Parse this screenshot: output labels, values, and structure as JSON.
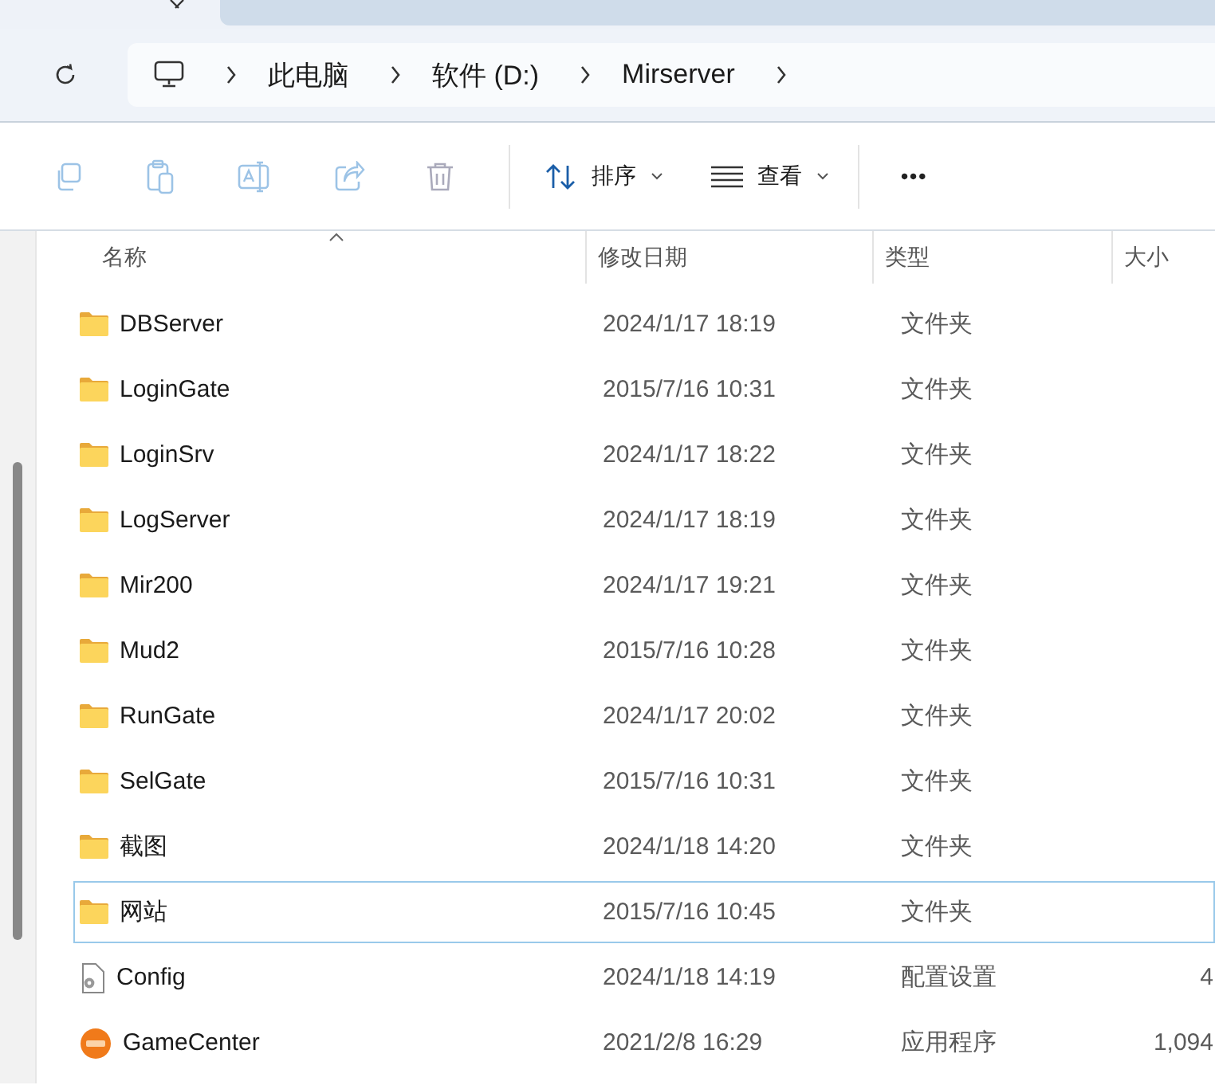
{
  "address_bar": {
    "crumbs": [
      "此电脑",
      "软件 (D:)",
      "Mirserver"
    ]
  },
  "toolbar": {
    "sort": "排序",
    "view": "查看",
    "more": "•••"
  },
  "table": {
    "columns": [
      {
        "label": "名称",
        "sorted": true
      },
      {
        "label": "修改日期",
        "sorted": false
      },
      {
        "label": "类型",
        "sorted": false
      },
      {
        "label": "大小",
        "sorted": false
      }
    ],
    "rows": [
      {
        "kind": "folder",
        "name": "DBServer",
        "date": "2024/1/17 18:19",
        "type": "文件夹",
        "focused": false
      },
      {
        "kind": "folder",
        "name": "LoginGate",
        "date": "2015/7/16 10:31",
        "type": "文件夹",
        "focused": false
      },
      {
        "kind": "folder",
        "name": "LoginSrv",
        "date": "2024/1/17 18:22",
        "type": "文件夹",
        "focused": false
      },
      {
        "kind": "folder",
        "name": "LogServer",
        "date": "2024/1/17 18:19",
        "type": "文件夹",
        "focused": false
      },
      {
        "kind": "folder",
        "name": "Mir200",
        "date": "2024/1/17 19:21",
        "type": "文件夹",
        "focused": false
      },
      {
        "kind": "folder",
        "name": "Mud2",
        "date": "2015/7/16 10:28",
        "type": "文件夹",
        "focused": false
      },
      {
        "kind": "folder",
        "name": "RunGate",
        "date": "2024/1/17 20:02",
        "type": "文件夹",
        "focused": false
      },
      {
        "kind": "folder",
        "name": "SelGate",
        "date": "2015/7/16 10:31",
        "type": "文件夹",
        "focused": false
      },
      {
        "kind": "folder",
        "name": "截图",
        "date": "2024/1/18 14:20",
        "type": "文件夹",
        "focused": false
      },
      {
        "kind": "folder",
        "name": "网站",
        "date": "2015/7/16 10:45",
        "type": "文件夹",
        "focused": true
      },
      {
        "kind": "config",
        "name": "Config",
        "date": "2024/1/18 14:19",
        "type": "配置设置",
        "size": "4",
        "focused": false
      },
      {
        "kind": "app",
        "name": "GameCenter",
        "date": "2021/2/8 16:29",
        "type": "应用程序",
        "size": "1,094",
        "focused": false
      }
    ]
  }
}
